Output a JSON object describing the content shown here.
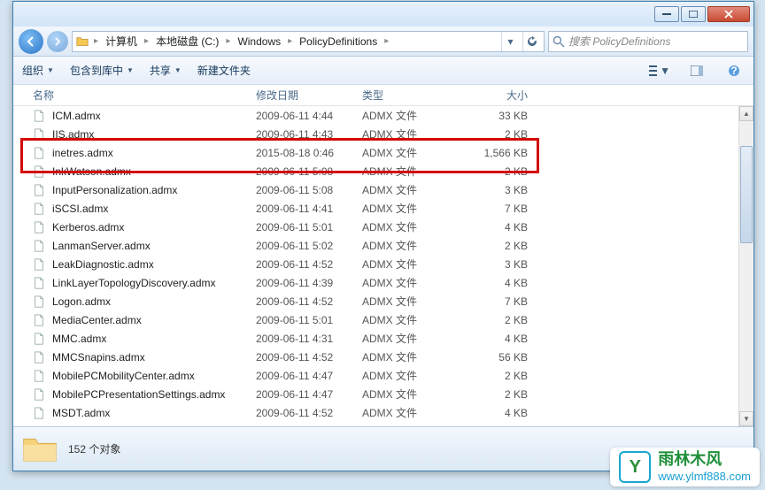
{
  "breadcrumbs": [
    "计算机",
    "本地磁盘 (C:)",
    "Windows",
    "PolicyDefinitions"
  ],
  "search": {
    "placeholder": "搜索 PolicyDefinitions"
  },
  "toolbar": {
    "organize": "组织",
    "include": "包含到库中",
    "share": "共享",
    "newfolder": "新建文件夹"
  },
  "columns": {
    "name": "名称",
    "date": "修改日期",
    "type": "类型",
    "size": "大小"
  },
  "files": [
    {
      "name": "ICM.admx",
      "date": "2009-06-11 4:44",
      "type": "ADMX 文件",
      "size": "33 KB"
    },
    {
      "name": "IIS.admx",
      "date": "2009-06-11 4:43",
      "type": "ADMX 文件",
      "size": "2 KB"
    },
    {
      "name": "inetres.admx",
      "date": "2015-08-18 0:46",
      "type": "ADMX 文件",
      "size": "1,566 KB"
    },
    {
      "name": "InkWatson.admx",
      "date": "2009-06-11 5:08",
      "type": "ADMX 文件",
      "size": "2 KB"
    },
    {
      "name": "InputPersonalization.admx",
      "date": "2009-06-11 5:08",
      "type": "ADMX 文件",
      "size": "3 KB"
    },
    {
      "name": "iSCSI.admx",
      "date": "2009-06-11 4:41",
      "type": "ADMX 文件",
      "size": "7 KB"
    },
    {
      "name": "Kerberos.admx",
      "date": "2009-06-11 5:01",
      "type": "ADMX 文件",
      "size": "4 KB"
    },
    {
      "name": "LanmanServer.admx",
      "date": "2009-06-11 5:02",
      "type": "ADMX 文件",
      "size": "2 KB"
    },
    {
      "name": "LeakDiagnostic.admx",
      "date": "2009-06-11 4:52",
      "type": "ADMX 文件",
      "size": "3 KB"
    },
    {
      "name": "LinkLayerTopologyDiscovery.admx",
      "date": "2009-06-11 4:39",
      "type": "ADMX 文件",
      "size": "4 KB"
    },
    {
      "name": "Logon.admx",
      "date": "2009-06-11 4:52",
      "type": "ADMX 文件",
      "size": "7 KB"
    },
    {
      "name": "MediaCenter.admx",
      "date": "2009-06-11 5:01",
      "type": "ADMX 文件",
      "size": "2 KB"
    },
    {
      "name": "MMC.admx",
      "date": "2009-06-11 4:31",
      "type": "ADMX 文件",
      "size": "4 KB"
    },
    {
      "name": "MMCSnapins.admx",
      "date": "2009-06-11 4:52",
      "type": "ADMX 文件",
      "size": "56 KB"
    },
    {
      "name": "MobilePCMobilityCenter.admx",
      "date": "2009-06-11 4:47",
      "type": "ADMX 文件",
      "size": "2 KB"
    },
    {
      "name": "MobilePCPresentationSettings.admx",
      "date": "2009-06-11 4:47",
      "type": "ADMX 文件",
      "size": "2 KB"
    },
    {
      "name": "MSDT.admx",
      "date": "2009-06-11 4:52",
      "type": "ADMX 文件",
      "size": "4 KB"
    }
  ],
  "highlight_index": 2,
  "status": {
    "count_text": "152 个对象"
  },
  "watermark": {
    "line1": "雨林木风",
    "line2": "www.ylmf888.com"
  }
}
